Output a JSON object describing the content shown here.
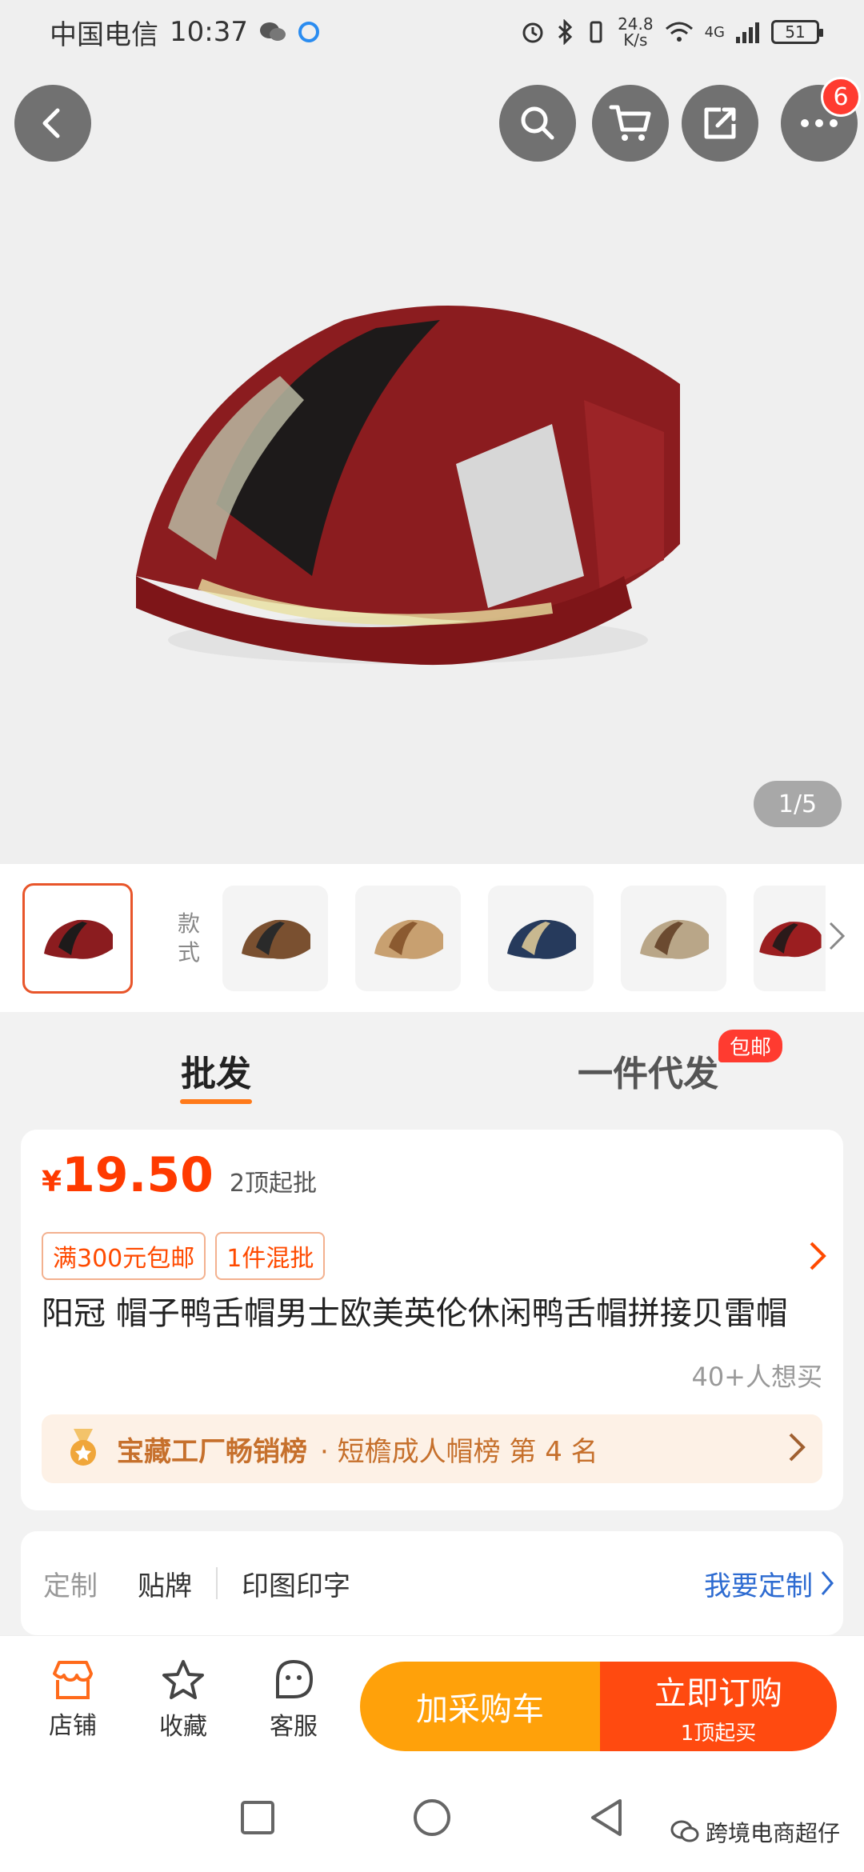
{
  "status_bar": {
    "carrier": "中国电信",
    "time": "10:37",
    "net_speed_value": "24.8",
    "net_speed_unit": "K/s",
    "network": "4G",
    "battery": "51"
  },
  "hero": {
    "pager": "1/5",
    "cart_badge": "6",
    "icons": [
      "back-icon",
      "search-icon",
      "cart-icon",
      "share-icon",
      "more-icon"
    ]
  },
  "styles": {
    "label": "款式",
    "thumb_count": 6
  },
  "tabs": [
    {
      "label": "批发",
      "active": true
    },
    {
      "label": "一件代发",
      "active": false,
      "badge": "包邮"
    }
  ],
  "product": {
    "currency": "¥",
    "price": "19.50",
    "min_order": "2顶起批",
    "tags": [
      "满300元包邮",
      "1件混批"
    ],
    "title": "阳冠 帽子鸭舌帽男士欧美英伦休闲鸭舌帽拼接贝雷帽",
    "want": "40+人想买",
    "rank_title": "宝藏工厂畅销榜",
    "rank_detail": "· 短檐成人帽榜  第 4 名"
  },
  "custom": {
    "label": "定制",
    "items": [
      "贴牌",
      "印图印字"
    ],
    "link": "我要定制"
  },
  "actions": {
    "shop": "店铺",
    "favorite": "收藏",
    "service": "客服",
    "add_cart": "加采购车",
    "buy": "立即订购",
    "buy_sub": "1顶起买"
  },
  "watermark": "跨境电商超仔",
  "colors": {
    "accent_orange": "#ff7a1a",
    "price_red": "#ff3a00",
    "cart_btn": "#ffa10a",
    "buy_btn": "#ff4a10",
    "link_blue": "#2d6bd1"
  }
}
